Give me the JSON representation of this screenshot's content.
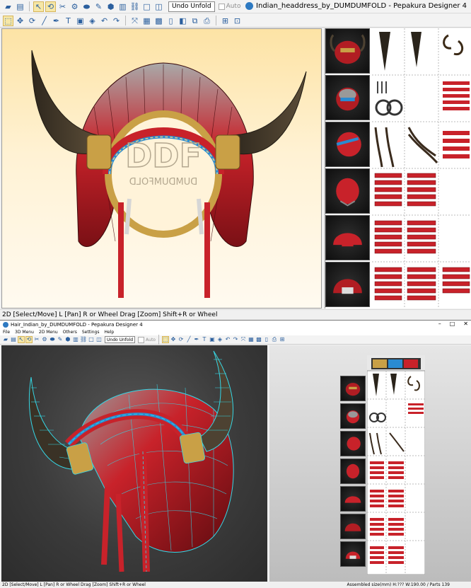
{
  "top_window": {
    "title": "Indian_headdress_by_DUMDUMFOLD - Pepakura Designer 4",
    "undo_unfold": "Undo Unfold",
    "auto_label": "Auto",
    "status": "2D [Select/Move] L [Pan] R or Wheel Drag [Zoom] Shift+R or Wheel",
    "watermark_line1": "DDF",
    "watermark_line2": "DUMDUMFOLD",
    "thumbnail_count": 6
  },
  "bottom_window": {
    "title": "Hair_Indian_by_DUMDUMFOLD - Pepakura Designer 4",
    "window_controls": [
      "–",
      "□",
      "✕"
    ],
    "menu": [
      "File",
      "3D Menu",
      "2D Menu",
      "Others",
      "Settings",
      "Help"
    ],
    "undo_unfold": "Undo Unfold",
    "auto_label": "Auto",
    "status": "2D [Select/Move] L [Pan] R or Wheel Drag [Zoom] Shift+R or Wheel",
    "status_right": "Assembled size(mm) H:??? W:190.00 / Parts 139",
    "thumbnail_count": 7
  },
  "colors": {
    "feather_red": "#c8222a",
    "feather_gray": "#9b9b9b",
    "horn_brown": "#4d4232",
    "band_gold": "#c9a046",
    "wire_cyan": "#35d7e6",
    "toolbar_bg": "#f3f3f3"
  },
  "icons": {
    "toolbar_top": [
      "open-icon",
      "save-icon",
      "cursor-icon",
      "rotate-icon",
      "edit-icon",
      "join-icon",
      "cylinder-icon",
      "paint-icon",
      "flap-icon",
      "bars-icon",
      "link-icon",
      "single-pane-icon",
      "split-pane-icon"
    ],
    "toolbar_second": [
      "select-icon",
      "move-icon",
      "rotate2d-icon",
      "line-icon",
      "pen-icon",
      "text-icon",
      "image-icon",
      "box-icon",
      "undo-icon",
      "redo-icon",
      "scale-icon",
      "layout-icon",
      "grid-icon",
      "page-icon",
      "fold-icon",
      "mirror-icon",
      "print-icon",
      "zoom-fit-icon",
      "zoom-sel-icon"
    ]
  }
}
